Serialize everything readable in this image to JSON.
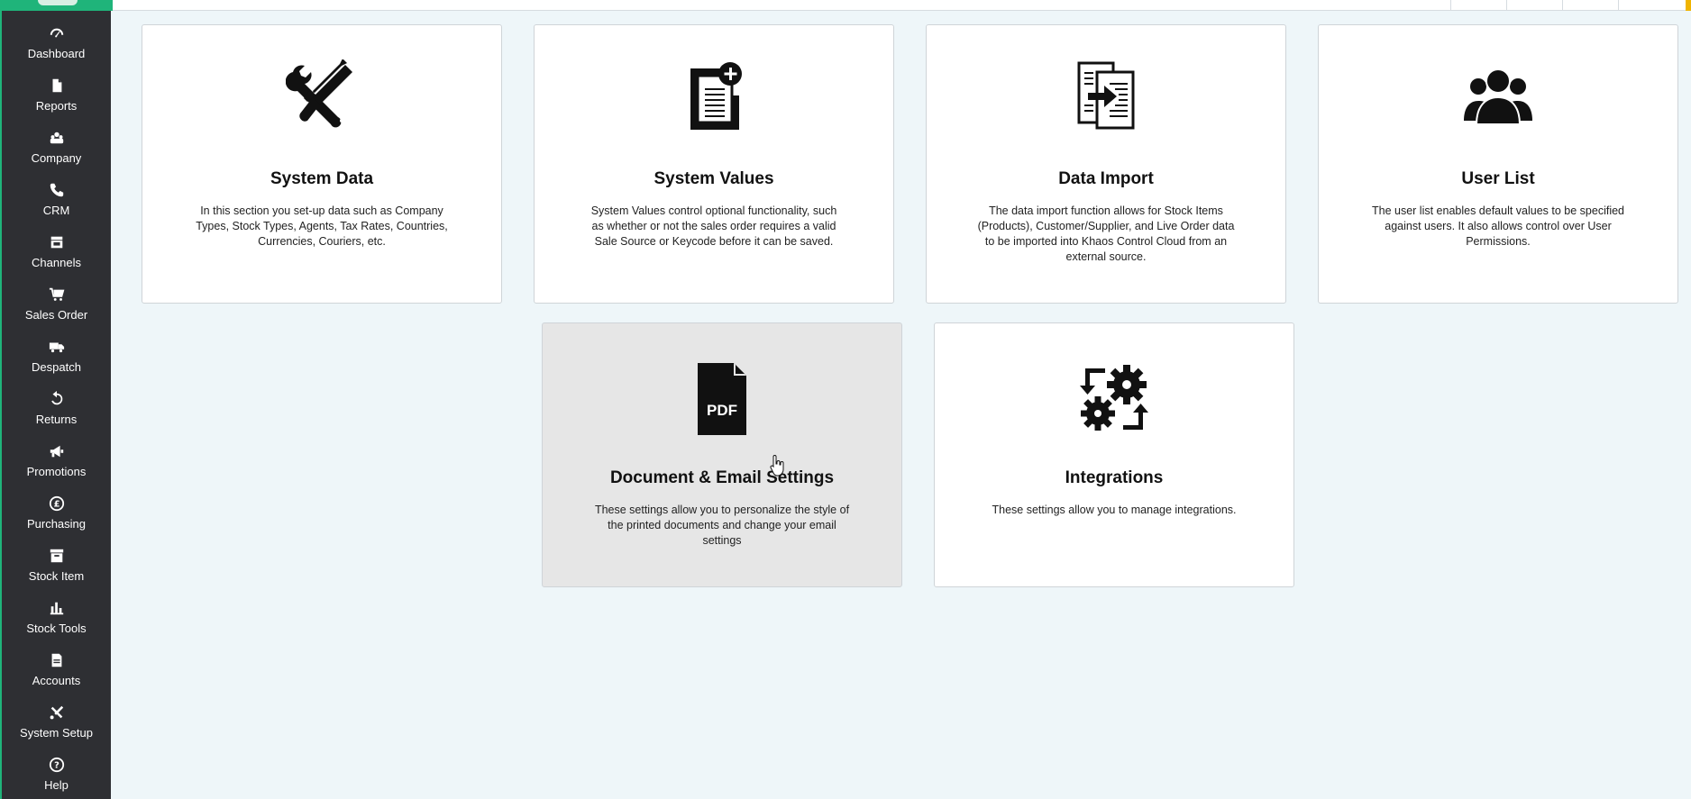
{
  "sidebar": {
    "items": [
      {
        "label": "Dashboard",
        "icon": "dashboard-gauge-icon"
      },
      {
        "label": "Reports",
        "icon": "document-icon"
      },
      {
        "label": "Company",
        "icon": "company-icon"
      },
      {
        "label": "CRM",
        "icon": "phone-icon"
      },
      {
        "label": "Channels",
        "icon": "store-icon"
      },
      {
        "label": "Sales Order",
        "icon": "cart-icon"
      },
      {
        "label": "Despatch",
        "icon": "truck-icon"
      },
      {
        "label": "Returns",
        "icon": "return-arrow-icon"
      },
      {
        "label": "Promotions",
        "icon": "megaphone-icon"
      },
      {
        "label": "Purchasing",
        "icon": "pound-coin-icon"
      },
      {
        "label": "Stock Item",
        "icon": "box-icon"
      },
      {
        "label": "Stock Tools",
        "icon": "bar-chart-icon"
      },
      {
        "label": "Accounts",
        "icon": "ledger-icon"
      },
      {
        "label": "System Setup",
        "icon": "wrench-screwdriver-icon"
      },
      {
        "label": "Help",
        "icon": "question-circle-icon"
      }
    ]
  },
  "cards": [
    {
      "title": "System Data",
      "description": "In this section you set-up data such as Company Types, Stock Types, Agents, Tax Rates, Countries, Currencies, Couriers, etc.",
      "icon": "wrench-screwdriver-icon"
    },
    {
      "title": "System Values",
      "description": "System Values control optional functionality, such as whether or not the sales order requires a valid Sale Source or Keycode before it can be saved.",
      "icon": "document-plus-icon"
    },
    {
      "title": "Data Import",
      "description": "The data import function allows for Stock Items (Products), Customer/Supplier, and Live Order data to be imported into Khaos Control Cloud from an external source.",
      "icon": "document-import-icon"
    },
    {
      "title": "User List",
      "description": "The user list enables default values to be specified against users. It also allows control over User Permissions.",
      "icon": "users-icon"
    },
    {
      "title": "Document & Email Settings",
      "description": "These settings allow you to personalize the style of the printed documents and change your email settings",
      "icon": "pdf-file-icon",
      "icon_text": "PDF"
    },
    {
      "title": "Integrations",
      "description": "These settings allow you to manage integrations.",
      "icon": "gears-sync-icon"
    }
  ]
}
